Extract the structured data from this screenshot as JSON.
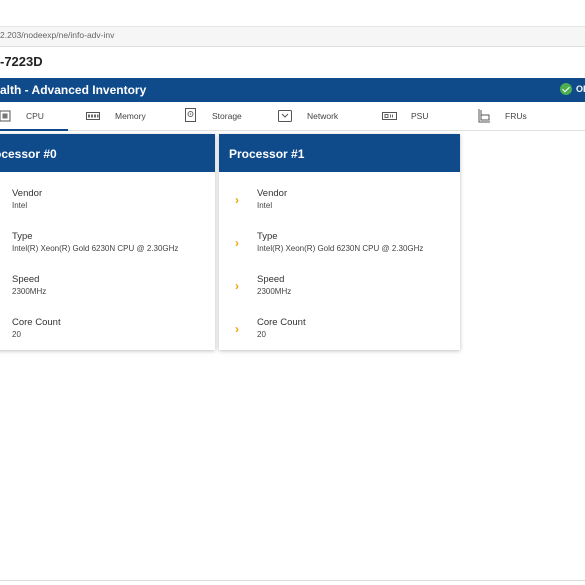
{
  "browser": {
    "url": "2.203/nodeexp/ne/info-adv-inv"
  },
  "header": {
    "hostname": "-7223D",
    "title": "alth - Advanced Inventory",
    "status_text": "OI"
  },
  "tabs": [
    {
      "label": "CPU",
      "icon": "cpu-icon",
      "selected": true
    },
    {
      "label": "Memory",
      "icon": "memory-icon"
    },
    {
      "label": "Storage",
      "icon": "storage-icon"
    },
    {
      "label": "Network",
      "icon": "network-icon"
    },
    {
      "label": "PSU",
      "icon": "psu-icon"
    },
    {
      "label": "FRUs",
      "icon": "fru-icon"
    }
  ],
  "processors": [
    {
      "title": "ocessor #0",
      "rows": [
        {
          "name": "Vendor",
          "value": "Intel"
        },
        {
          "name": "Type",
          "value": "Intel(R) Xeon(R) Gold 6230N CPU @ 2.30GHz"
        },
        {
          "name": "Speed",
          "value": "2300MHz"
        },
        {
          "name": "Core Count",
          "value": "20"
        }
      ]
    },
    {
      "title": "Processor #1",
      "rows": [
        {
          "name": "Vendor",
          "value": "Intel"
        },
        {
          "name": "Type",
          "value": "Intel(R) Xeon(R) Gold 6230N CPU @ 2.30GHz"
        },
        {
          "name": "Speed",
          "value": "2300MHz"
        },
        {
          "name": "Core Count",
          "value": "20"
        }
      ]
    }
  ],
  "colors": {
    "brand": "#0f4a8a",
    "status_ok": "#4caf50",
    "chevron": "#f0a500"
  }
}
